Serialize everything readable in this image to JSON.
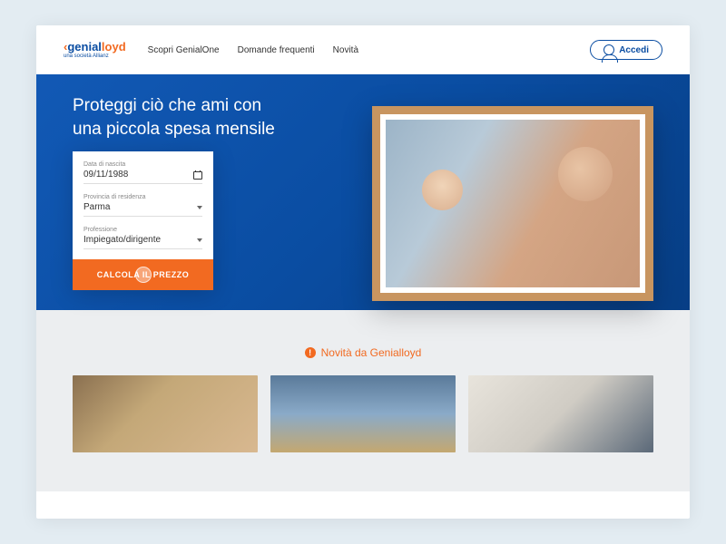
{
  "brand": {
    "name": "genialloyd",
    "sub": "una società Allianz"
  },
  "nav": {
    "items": [
      "Scopri GenialOne",
      "Domande frequenti",
      "Novità"
    ]
  },
  "login": {
    "label": "Accedi"
  },
  "hero": {
    "title": "Proteggi ciò che ami con una piccola spesa mensile"
  },
  "form": {
    "birth": {
      "label": "Data di nascita",
      "value": "09/11/1988"
    },
    "province": {
      "label": "Provincia di residenza",
      "value": "Parma"
    },
    "profession": {
      "label": "Professione",
      "value": "Impiegato/dirigente"
    },
    "cta": "CALCOLA IL PREZZO"
  },
  "news": {
    "title": "Novità da Genialloyd"
  }
}
